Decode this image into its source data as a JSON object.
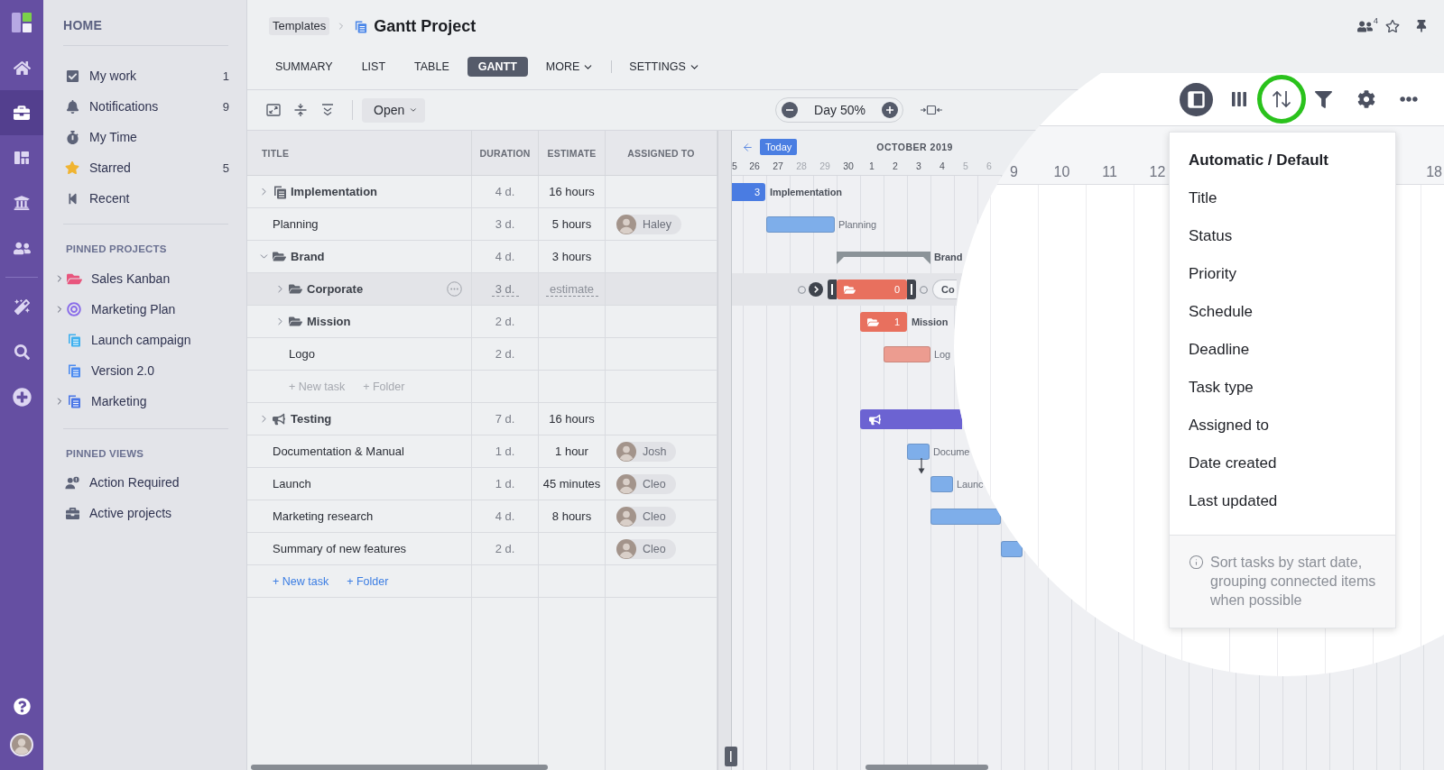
{
  "rail": {
    "items": [
      {
        "selected": false
      },
      {
        "selected": true
      },
      {
        "selected": false
      },
      {
        "selected": false
      },
      {
        "selected": false
      },
      {
        "selected": false
      },
      {
        "selected": false
      },
      {
        "selected": false
      }
    ]
  },
  "sidebar": {
    "title": "HOME",
    "items": [
      {
        "label": "My work",
        "count": "1"
      },
      {
        "label": "Notifications",
        "count": "9"
      },
      {
        "label": "My Time"
      },
      {
        "label": "Starred",
        "count": "5"
      },
      {
        "label": "Recent"
      }
    ],
    "sections": [
      {
        "title": "PINNED PROJECTS",
        "items": [
          {
            "label": "Sales Kanban",
            "expandable": true,
            "color": "#e8557d"
          },
          {
            "label": "Marketing Plan",
            "expandable": true,
            "color": "#8a6de9"
          },
          {
            "label": "Launch campaign",
            "expandable": false,
            "color": "#3fb0ef"
          },
          {
            "label": "Version 2.0",
            "expandable": false,
            "color": "#4c8bf0"
          },
          {
            "label": "Marketing",
            "expandable": true,
            "color": "#4a76e6"
          }
        ]
      },
      {
        "title": "PINNED VIEWS",
        "items": [
          {
            "label": "Action Required"
          },
          {
            "label": "Active projects"
          }
        ]
      }
    ]
  },
  "header": {
    "breadcrumb": "Templates",
    "title": "Gantt Project",
    "members_count": "4"
  },
  "tabs": [
    {
      "label": "SUMMARY",
      "selected": false
    },
    {
      "label": "LIST",
      "selected": false
    },
    {
      "label": "TABLE",
      "selected": false
    },
    {
      "label": "GANTT",
      "selected": true
    },
    {
      "label": "MORE",
      "selected": false,
      "menu": true
    }
  ],
  "settings": {
    "label": "SETTINGS"
  },
  "toolbar": {
    "filter": "Open",
    "zoom": "Day 50%"
  },
  "table": {
    "columns": [
      "TITLE",
      "DURATION",
      "ESTIMATE",
      "ASSIGNED TO"
    ],
    "rows": [
      {
        "kind": "project",
        "title": "Implementation",
        "expanded": false,
        "selected": false,
        "duration": "4 d.",
        "estimate": "16 hours",
        "bar": {
          "kind": "project",
          "color": "#4a7ce2",
          "count": "3",
          "label": "Implementation"
        }
      },
      {
        "kind": "task",
        "title": "Planning",
        "selected": false,
        "duration": "3 d.",
        "estimate": "5 hours",
        "assignee": "Haley",
        "bar": {
          "kind": "task",
          "color": "#7eaeea",
          "label": "Planning"
        }
      },
      {
        "kind": "folder",
        "title": "Brand",
        "expanded": true,
        "selected": false,
        "duration": "4 d.",
        "estimate": "3 hours",
        "bar": {
          "kind": "summary",
          "color": "#8b9398",
          "label": "Brand"
        },
        "children": [
          {
            "kind": "folder",
            "title": "Corporate",
            "expanded": false,
            "selected": true,
            "duration": "3 d.",
            "estimate_placeholder": "estimate",
            "bar": {
              "kind": "folder",
              "color": "#e8705e",
              "count": "0",
              "label": "Co"
            }
          },
          {
            "kind": "folder",
            "title": "Mission",
            "expanded": false,
            "selected": false,
            "duration": "2 d.",
            "bar": {
              "kind": "folder",
              "color": "#e8705e",
              "count": "1",
              "label": "Mission"
            }
          },
          {
            "kind": "task",
            "title": "Logo",
            "selected": false,
            "duration": "2 d.",
            "bar": {
              "kind": "task",
              "color": "#ec9c90",
              "label": "Log"
            }
          },
          {
            "kind": "add",
            "actions": [
              "+ New task",
              "+ Folder"
            ],
            "muted": true
          }
        ]
      },
      {
        "kind": "milestone",
        "title": "Testing",
        "expanded": false,
        "selected": false,
        "duration": "7 d.",
        "estimate": "16 hours",
        "bar": {
          "kind": "milestone",
          "color": "#6c63d2"
        }
      },
      {
        "kind": "task",
        "title": "Documentation & Manual",
        "selected": false,
        "duration": "1 d.",
        "estimate": "1 hour",
        "assignee": "Josh",
        "bar": {
          "kind": "task",
          "color": "#7eaeea",
          "label": "Docume"
        }
      },
      {
        "kind": "task",
        "title": "Launch",
        "selected": false,
        "duration": "1 d.",
        "estimate": "45 minutes",
        "assignee": "Cleo",
        "bar": {
          "kind": "task",
          "color": "#7eaeea",
          "label": "Launc",
          "dependent": true
        }
      },
      {
        "kind": "task",
        "title": "Marketing research",
        "selected": false,
        "duration": "4 d.",
        "estimate": "8 hours",
        "assignee": "Cleo",
        "bar": {
          "kind": "task",
          "color": "#7eaeea"
        }
      },
      {
        "kind": "task",
        "title": "Summary of new features",
        "selected": false,
        "duration": "2 d.",
        "assignee": "Cleo",
        "bar": {
          "kind": "task",
          "color": "#7eaeea"
        }
      },
      {
        "kind": "add",
        "actions": [
          "+ New task",
          "+ Folder"
        ],
        "muted": false
      }
    ]
  },
  "gantt": {
    "today": "Today",
    "month": "OCTOBER 2019",
    "days": [
      {
        "label": "5",
        "weekend": false
      },
      {
        "label": "26",
        "weekend": false
      },
      {
        "label": "27",
        "weekend": false
      },
      {
        "label": "28",
        "weekend": true
      },
      {
        "label": "29",
        "weekend": true
      },
      {
        "label": "30",
        "weekend": false
      },
      {
        "label": "1",
        "weekend": false
      },
      {
        "label": "2",
        "weekend": false
      },
      {
        "label": "3",
        "weekend": false
      },
      {
        "label": "4",
        "weekend": false
      },
      {
        "label": "5",
        "weekend": true
      },
      {
        "label": "6",
        "weekend": true
      }
    ]
  },
  "magnifier": {
    "buttons": [
      {
        "active": true,
        "highlighted": false
      },
      {
        "active": false,
        "highlighted": false
      },
      {
        "active": false,
        "highlighted": true
      },
      {
        "active": false,
        "highlighted": false
      },
      {
        "active": false,
        "highlighted": false
      },
      {
        "active": false,
        "highlighted": false
      }
    ],
    "days": [
      "9",
      "10",
      "11",
      "12",
      "18"
    ],
    "sort_menu": {
      "options": [
        {
          "label": "Automatic / Default",
          "selected": true
        },
        {
          "label": "Title",
          "selected": false
        },
        {
          "label": "Status",
          "selected": false
        },
        {
          "label": "Priority",
          "selected": false
        },
        {
          "label": "Schedule",
          "selected": false
        },
        {
          "label": "Deadline",
          "selected": false
        },
        {
          "label": "Task type",
          "selected": false
        },
        {
          "label": "Assigned to",
          "selected": false
        },
        {
          "label": "Date created",
          "selected": false
        },
        {
          "label": "Last updated",
          "selected": false
        }
      ],
      "hint": "Sort tasks by start date, grouping connected items when possible"
    }
  }
}
